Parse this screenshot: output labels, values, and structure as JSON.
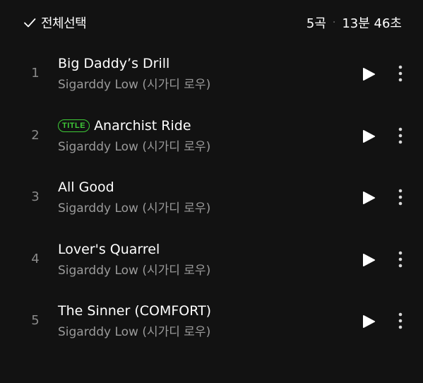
{
  "header": {
    "select_all_label": "전체선택",
    "track_count": "5곡",
    "separator": "·",
    "total_duration": "13분 46초"
  },
  "tracks": [
    {
      "number": "1",
      "title": "Big Daddy’s Drill",
      "artist": "Sigarddy Low (시가디 로우)",
      "badge": ""
    },
    {
      "number": "2",
      "title": "Anarchist Ride",
      "artist": "Sigarddy Low (시가디 로우)",
      "badge": "TITLE"
    },
    {
      "number": "3",
      "title": "All Good",
      "artist": "Sigarddy Low (시가디 로우)",
      "badge": ""
    },
    {
      "number": "4",
      "title": "Lover's Quarrel",
      "artist": "Sigarddy Low (시가디 로우)",
      "badge": ""
    },
    {
      "number": "5",
      "title": "The Sinner (COMFORT)",
      "artist": "Sigarddy Low (시가디 로우)",
      "badge": ""
    }
  ],
  "icons": {
    "check": "check-icon",
    "play": "play-icon",
    "more": "more-vertical-icon"
  },
  "colors": {
    "background": "#121212",
    "title_badge": "#3fcb38",
    "secondary_text": "#9a9a9a"
  }
}
